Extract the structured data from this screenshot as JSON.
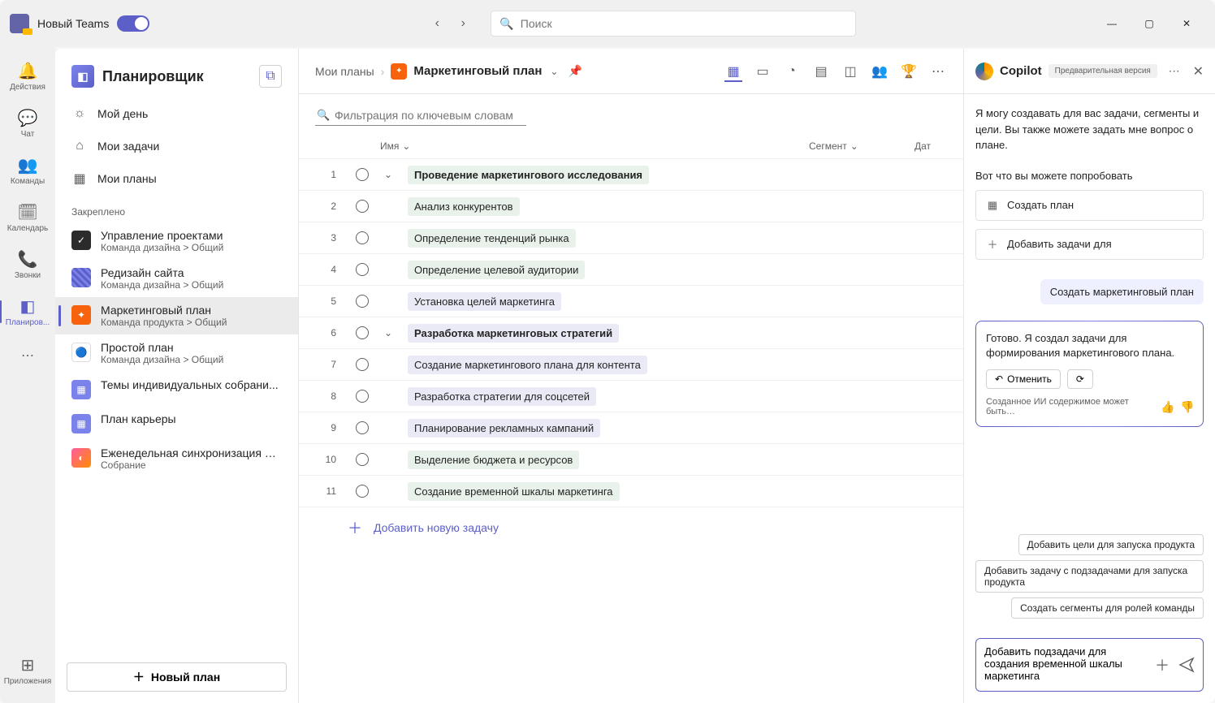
{
  "titlebar": {
    "app_name": "Новый Teams",
    "search_placeholder": "Поиск"
  },
  "rail": {
    "items": [
      {
        "label": "Действия",
        "icon": "🔔"
      },
      {
        "label": "Чат",
        "icon": "💬"
      },
      {
        "label": "Команды",
        "icon": "👥"
      },
      {
        "label": "Календарь",
        "icon": "📅"
      },
      {
        "label": "Звонки",
        "icon": "📞"
      },
      {
        "label": "Планиров...",
        "icon": "◧",
        "active": true
      }
    ],
    "apps_label": "Приложения"
  },
  "sidebar": {
    "title": "Планировщик",
    "items": [
      {
        "label": "Мой день",
        "icon": "☀"
      },
      {
        "label": "Мои задачи",
        "icon": "⌂"
      },
      {
        "label": "Мои планы",
        "icon": "▦"
      }
    ],
    "pinned_label": "Закреплено",
    "plans": [
      {
        "name": "Управление проектами",
        "sub": "Команда дизайна > Общий",
        "color": "#2b2b2b"
      },
      {
        "name": "Редизайн сайта",
        "sub": "Команда дизайна > Общий",
        "color": "#5b5fc7"
      },
      {
        "name": "Маркетинговый план",
        "sub": "Команда продукта > Общий",
        "color": "#f7630c",
        "active": true
      },
      {
        "name": "Простой план",
        "sub": "Команда дизайна > Общий",
        "color": "#ffffff"
      },
      {
        "name": "Темы индивидуальных собрани...",
        "sub": "",
        "color": "#7b83eb"
      },
      {
        "name": "План карьеры",
        "sub": "",
        "color": "#7b83eb"
      },
      {
        "name": "Еженедельная синхронизация ди...",
        "sub": "Собрание",
        "color": "#ff5ca1"
      }
    ],
    "new_plan_label": "Новый план"
  },
  "content": {
    "breadcrumb_parent": "Мои планы",
    "breadcrumb_title": "Маркетинговый план",
    "filter_placeholder": "Фильтрация по ключевым словам",
    "columns": {
      "name": "Имя",
      "segment": "Сегмент",
      "date": "Дат"
    },
    "tasks": [
      {
        "num": "1",
        "name": "Проведение маркетингового исследования",
        "bold": true,
        "expand": true,
        "color": "#e8f2ea"
      },
      {
        "num": "2",
        "name": "Анализ конкурентов",
        "color": "#e8f2ea"
      },
      {
        "num": "3",
        "name": "Определение тенденций рынка",
        "color": "#e8f2ea"
      },
      {
        "num": "4",
        "name": "Определение целевой аудитории",
        "color": "#e8f2ea"
      },
      {
        "num": "5",
        "name": "Установка целей маркетинга",
        "color": "#eaeaf7"
      },
      {
        "num": "6",
        "name": "Разработка маркетинговых стратегий",
        "bold": true,
        "expand": true,
        "color": "#eaeaf7"
      },
      {
        "num": "7",
        "name": "Создание маркетингового плана для контента",
        "color": "#eaeaf7"
      },
      {
        "num": "8",
        "name": "Разработка стратегии для соцсетей",
        "color": "#eaeaf7"
      },
      {
        "num": "9",
        "name": "Планирование рекламных кампаний",
        "color": "#eaeaf7"
      },
      {
        "num": "10",
        "name": "Выделение бюджета и ресурсов",
        "color": "#e8f2ea"
      },
      {
        "num": "11",
        "name": "Создание временной шкалы маркетинга",
        "color": "#e8f2ea"
      }
    ],
    "add_task_label": "Добавить новую задачу"
  },
  "copilot": {
    "title": "Copilot",
    "badge": "Предварительная версия",
    "intro": "Я могу создавать для вас задачи, сегменты и цели. Вы также можете задать мне вопрос о плане.",
    "try_label": "Вот что вы можете попробовать",
    "cards": [
      {
        "label": "Создать план",
        "icon": "▦"
      },
      {
        "label": "Добавить задачи для",
        "icon": "+"
      }
    ],
    "user_msg": "Создать маркетинговый план",
    "ai_msg": "Готово. Я создал задачи для формирования маркетингового плана.",
    "undo_label": "Отменить",
    "disclaimer": "Созданное ИИ содержимое может быть…",
    "suggestions": [
      "Добавить цели для запуска продукта",
      "Добавить задачу с подзадачами для запуска продукта",
      "Создать сегменты для ролей команды"
    ],
    "input_value": "Добавить подзадачи для создания временной шкалы маркетинга"
  }
}
